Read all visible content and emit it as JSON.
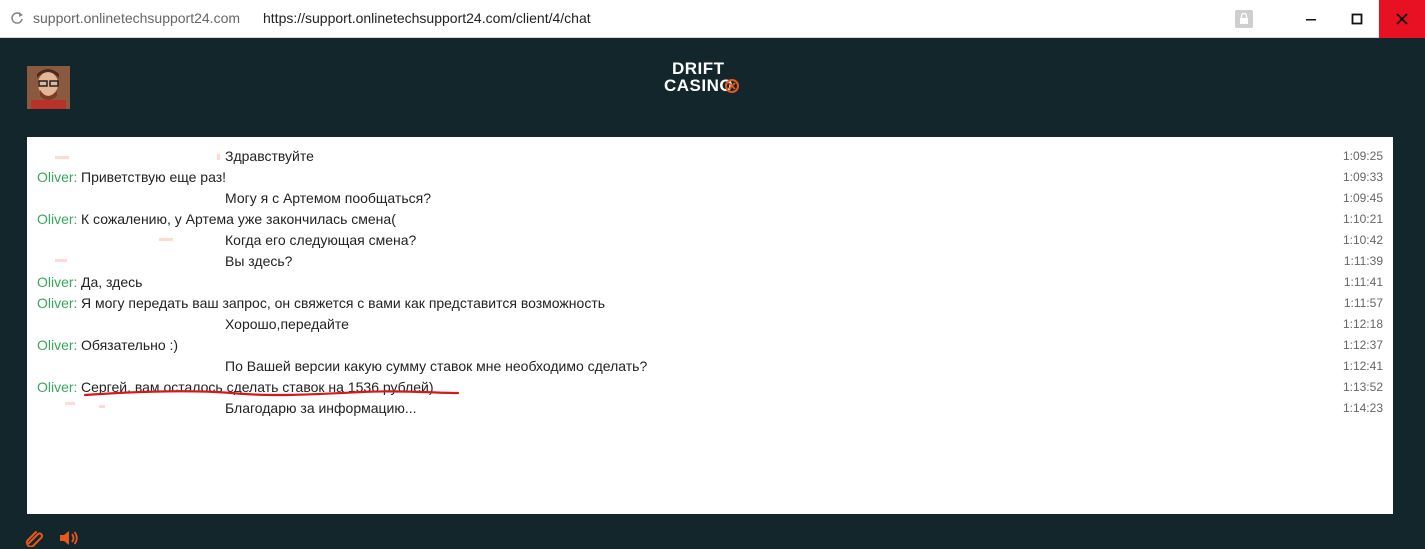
{
  "browser": {
    "domain": "support.onlinetechsupport24.com",
    "url": "https://support.onlinetechsupport24.com/client/4/chat",
    "controls": {
      "minimize": "—",
      "close": "✕"
    }
  },
  "header": {
    "logo_line1": "DRIFT",
    "logo_line2": "CASINO"
  },
  "colors": {
    "background": "#13262c",
    "operator_name": "#3aa55c",
    "close_button": "#e81123",
    "accent": "#e8581c"
  },
  "messages": [
    {
      "sender": "",
      "text": "Здравствуйте",
      "time": "1:09:25"
    },
    {
      "sender": "Oliver:",
      "text": "Приветствую еще раз!",
      "time": "1:09:33"
    },
    {
      "sender": "",
      "text": "Могу я с Артемом пообщаться?",
      "time": "1:09:45"
    },
    {
      "sender": "Oliver:",
      "text": "К сожалению, у Артема уже закончилась смена(",
      "time": "1:10:21"
    },
    {
      "sender": "",
      "text": "Когда его следующая смена?",
      "time": "1:10:42"
    },
    {
      "sender": "",
      "text": "Вы здесь?",
      "time": "1:11:39"
    },
    {
      "sender": "Oliver:",
      "text": "Да, здесь",
      "time": "1:11:41"
    },
    {
      "sender": "Oliver:",
      "text": "Я могу передать ваш запрос, он свяжется с вами как представится возможность",
      "time": "1:11:57"
    },
    {
      "sender": "",
      "text": "Хорошо,передайте",
      "time": "1:12:18"
    },
    {
      "sender": "Oliver:",
      "text": "Обязательно :)",
      "time": "1:12:37"
    },
    {
      "sender": "",
      "text": "По Вашей версии какую сумму ставок мне необходимо сделать?",
      "time": "1:12:41"
    },
    {
      "sender": "Oliver:",
      "text": "Сергей, вам осталось сделать ставок на 1536 рублей)",
      "time": "1:13:52"
    },
    {
      "sender": "",
      "text": "Благодарю за информацию...",
      "time": "1:14:23"
    }
  ],
  "icons": {
    "attach": "paperclip-icon",
    "sound": "speaker-icon",
    "reload": "reload-icon",
    "lock": "lock-icon"
  }
}
